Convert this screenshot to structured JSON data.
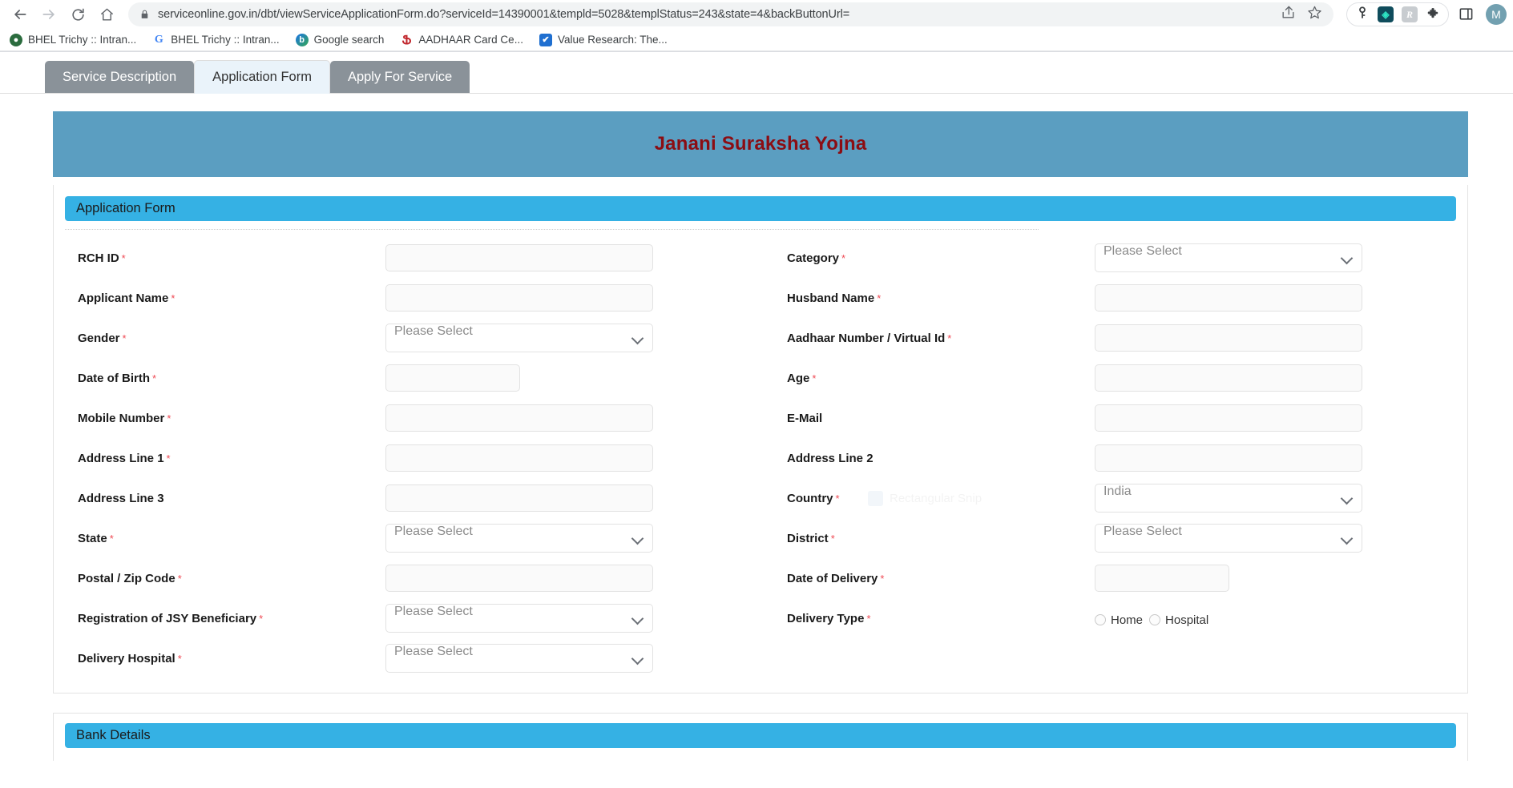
{
  "browser": {
    "url": "serviceonline.gov.in/dbt/viewServiceApplicationForm.do?serviceId=14390001&templd=5028&templStatus=243&state=4&backButtonUrl=",
    "back_icon": "back-arrow-icon",
    "forward_icon": "forward-arrow-icon",
    "reload_icon": "reload-icon",
    "home_icon": "home-icon",
    "lock_icon": "lock-icon",
    "share_icon": "share-icon",
    "bookmark_icon": "star-icon",
    "password_icon": "key-icon",
    "extension_teal_label": "◈",
    "extension_grey_label": "R",
    "puzzle_icon": "puzzle-icon",
    "side_panel_icon": "side-panel-icon",
    "avatar_label": "M",
    "bookmarks": [
      {
        "label": "BHEL Trichy :: Intran...",
        "icon": "globe-favicon",
        "glyph": "●"
      },
      {
        "label": "BHEL Trichy :: Intran...",
        "icon": "google-favicon",
        "glyph": "G"
      },
      {
        "label": "Google search",
        "icon": "blue-b-favicon",
        "glyph": "b"
      },
      {
        "label": "AADHAAR Card Ce...",
        "icon": "aadhaar-favicon",
        "glyph": "Ֆ"
      },
      {
        "label": "Value Research: The...",
        "icon": "value-research-favicon",
        "glyph": "✔"
      }
    ]
  },
  "tabs": [
    {
      "label": "Service Description",
      "active": false
    },
    {
      "label": "Application Form",
      "active": true
    },
    {
      "label": "Apply For Service",
      "active": false
    }
  ],
  "page_title": "Janani Suraksha Yojna",
  "sections": {
    "application_form": "Application Form",
    "bank_details": "Bank Details"
  },
  "placeholders": {
    "please_select": "Please Select",
    "empty": ""
  },
  "overlay": {
    "snip_tooltip": "Rectangular Snip"
  },
  "fields": {
    "rch_id": {
      "label": "RCH ID",
      "required": true,
      "type": "text",
      "value": ""
    },
    "category": {
      "label": "Category",
      "required": true,
      "type": "select",
      "value": "Please Select"
    },
    "applicant_name": {
      "label": "Applicant Name",
      "required": true,
      "type": "text",
      "value": ""
    },
    "husband_name": {
      "label": "Husband Name",
      "required": true,
      "type": "text",
      "value": ""
    },
    "gender": {
      "label": "Gender",
      "required": true,
      "type": "select",
      "value": "Please Select"
    },
    "aadhaar_number": {
      "label": "Aadhaar Number / Virtual Id",
      "required": true,
      "type": "text",
      "value": ""
    },
    "date_of_birth": {
      "label": "Date of Birth",
      "required": true,
      "type": "date",
      "value": ""
    },
    "age": {
      "label": "Age",
      "required": true,
      "type": "text",
      "value": ""
    },
    "mobile_number": {
      "label": "Mobile Number",
      "required": true,
      "type": "text",
      "value": ""
    },
    "email": {
      "label": "E-Mail",
      "required": false,
      "type": "text",
      "value": ""
    },
    "address_line_1": {
      "label": "Address Line 1",
      "required": true,
      "type": "text",
      "value": ""
    },
    "address_line_2": {
      "label": "Address Line 2",
      "required": false,
      "type": "text",
      "value": ""
    },
    "address_line_3": {
      "label": "Address Line 3",
      "required": false,
      "type": "text",
      "value": ""
    },
    "country": {
      "label": "Country",
      "required": true,
      "type": "select",
      "value": "India"
    },
    "state": {
      "label": "State",
      "required": true,
      "type": "select",
      "value": "Please Select"
    },
    "district": {
      "label": "District",
      "required": true,
      "type": "select",
      "value": "Please Select"
    },
    "postal_zip_code": {
      "label": "Postal / Zip Code",
      "required": true,
      "type": "text",
      "value": ""
    },
    "date_of_delivery": {
      "label": "Date of Delivery",
      "required": true,
      "type": "date",
      "value": ""
    },
    "registration_jsy": {
      "label": "Registration of JSY Beneficiary",
      "required": true,
      "type": "select",
      "value": "Please Select"
    },
    "delivery_type": {
      "label": "Delivery Type",
      "required": true,
      "type": "radio",
      "options": [
        {
          "label": "Home",
          "selected": false
        },
        {
          "label": "Hospital",
          "selected": false
        }
      ]
    },
    "delivery_hospital": {
      "label": "Delivery Hospital",
      "required": true,
      "type": "select",
      "value": "Please Select"
    }
  },
  "colors": {
    "banner_blue": "#5b9ec1",
    "section_blue": "#35b1e4",
    "title_red": "#8b0d13",
    "tab_grey": "#8a9299",
    "tab_active": "#eaf3fa",
    "required_red": "#ef4b55"
  }
}
